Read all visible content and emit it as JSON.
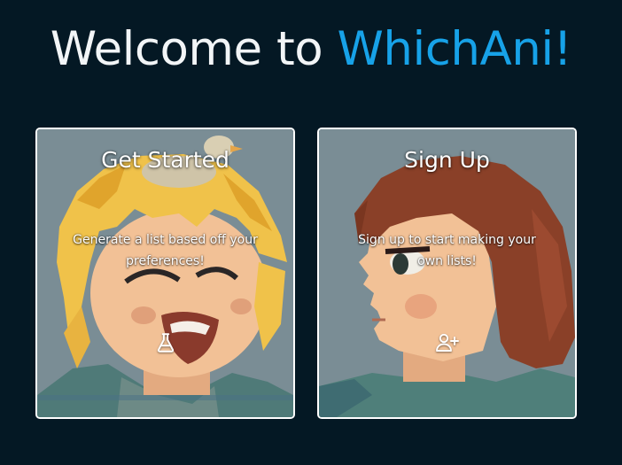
{
  "header": {
    "title_prefix": "Welcome to ",
    "title_brand": "WhichAni!",
    "brand_color": "#17a2e8"
  },
  "cards": [
    {
      "title": "Get Started",
      "description": "Generate a list based off your preferences!",
      "icon": "flask-icon"
    },
    {
      "title": "Sign Up",
      "description": "Sign up to start making your own lists!",
      "icon": "user-plus-icon"
    }
  ],
  "colors": {
    "background": "#041824",
    "card_border": "#ffffff",
    "card_background": "#7a8d95"
  }
}
